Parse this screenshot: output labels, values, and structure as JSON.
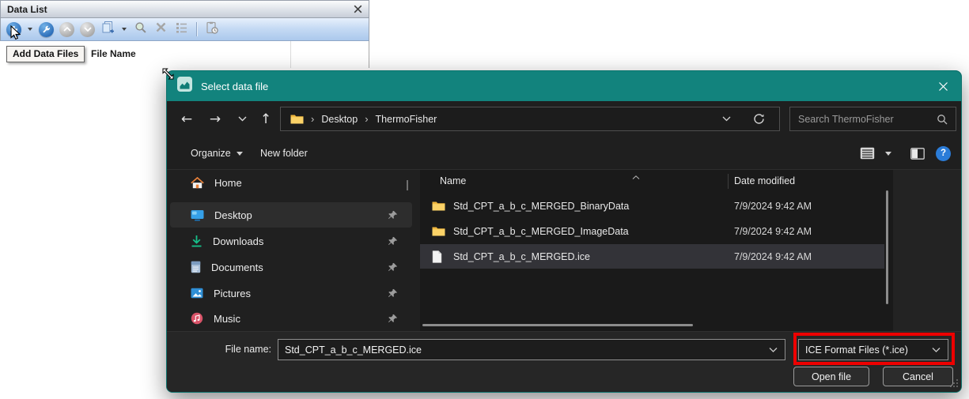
{
  "colors": {
    "titlebar_teal": "#12837d",
    "annotation_red": "#ee0000",
    "datalist_toolbar_blue": "#b9d1ef",
    "selection_gray": "#333338"
  },
  "data_list": {
    "title": "Data List",
    "tooltip": "Add Data Files",
    "column_header": "File Name",
    "toolbar_icons": [
      "add-data-files-icon",
      "add-dropdown-caret",
      "tools-icon",
      "move-up-icon",
      "move-down-icon",
      "copy-icon",
      "copy-dropdown-caret",
      "search-icon",
      "remove-icon",
      "view-options-icon",
      "report-icon"
    ]
  },
  "dialog": {
    "title": "Select data file",
    "nav": {
      "breadcrumb": [
        "Desktop",
        "ThermoFisher"
      ],
      "search_placeholder": "Search ThermoFisher",
      "icons": [
        "back-icon",
        "forward-icon",
        "recent-locations-icon",
        "up-icon",
        "folder-icon",
        "refresh-icon",
        "search-icon"
      ]
    },
    "toolbar": {
      "organize": "Organize",
      "new_folder": "New folder",
      "icons": [
        "view-list-icon",
        "view-dropdown-caret",
        "preview-pane-icon",
        "help-icon"
      ]
    },
    "sidebar": {
      "items": [
        {
          "label": "Home",
          "icon": "home-icon",
          "pinned": false,
          "selected": false
        },
        {
          "label": "Desktop",
          "icon": "desktop-icon",
          "pinned": true,
          "selected": true
        },
        {
          "label": "Downloads",
          "icon": "downloads-icon",
          "pinned": true,
          "selected": false
        },
        {
          "label": "Documents",
          "icon": "documents-icon",
          "pinned": true,
          "selected": false
        },
        {
          "label": "Pictures",
          "icon": "pictures-icon",
          "pinned": true,
          "selected": false
        },
        {
          "label": "Music",
          "icon": "music-icon",
          "pinned": true,
          "selected": false
        }
      ]
    },
    "file_list": {
      "columns": [
        "Name",
        "Date modified"
      ],
      "sort": "ascending",
      "rows": [
        {
          "name": "Std_CPT_a_b_c_MERGED_BinaryData",
          "type": "folder",
          "date_modified": "7/9/2024 9:42 AM",
          "selected": false
        },
        {
          "name": "Std_CPT_a_b_c_MERGED_ImageData",
          "type": "folder",
          "date_modified": "7/9/2024 9:42 AM",
          "selected": false
        },
        {
          "name": "Std_CPT_a_b_c_MERGED.ice",
          "type": "file",
          "date_modified": "7/9/2024 9:42 AM",
          "selected": true
        }
      ]
    },
    "footer": {
      "file_name_label": "File name:",
      "file_name_value": "Std_CPT_a_b_c_MERGED.ice",
      "file_type_value": "ICE Format Files (*.ice)",
      "open_label": "Open file",
      "cancel_label": "Cancel"
    }
  }
}
